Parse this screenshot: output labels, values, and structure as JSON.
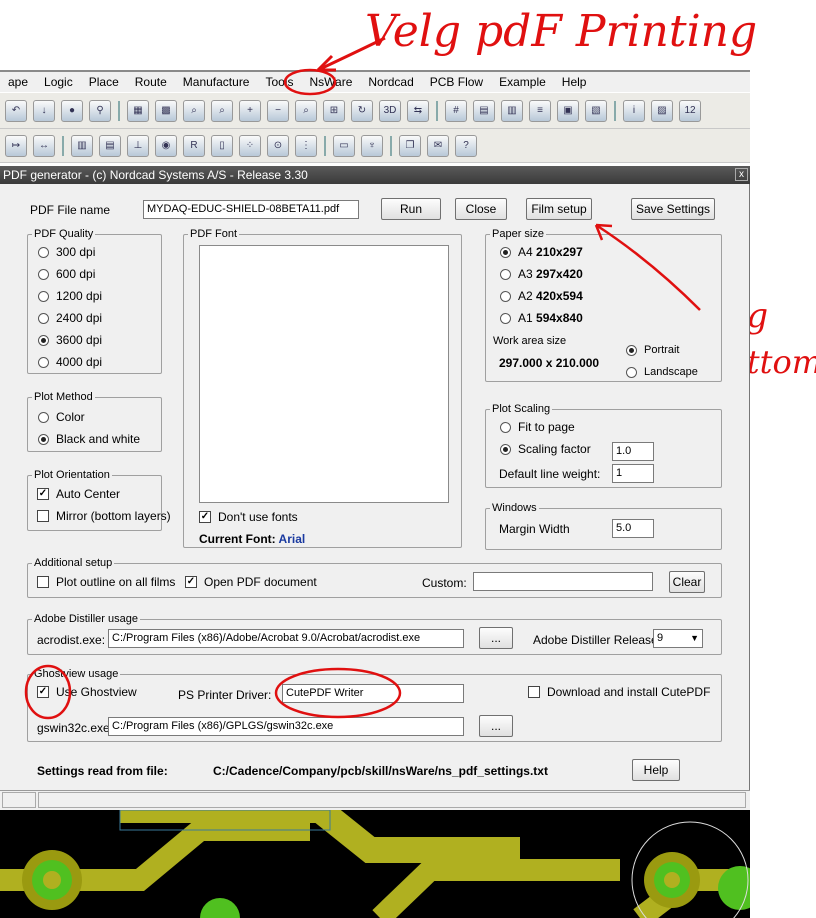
{
  "annotations": {
    "top": "Velg pdF Printing",
    "side_1": "Velg",
    "side_2": "Bottom"
  },
  "menu": [
    "ape",
    "Logic",
    "Place",
    "Route",
    "Manufacture",
    "Tools",
    "NsWare",
    "Nordcad",
    "PCB Flow",
    "Example",
    "Help"
  ],
  "dialog": {
    "title": "PDF generator - (c) Nordcad Systems A/S - Release 3.30",
    "close_glyph": "x",
    "pdf_file_label": "PDF File name",
    "pdf_file_value": "MYDAQ-EDUC-SHIELD-08BETA11.pdf",
    "buttons": {
      "run": "Run",
      "close": "Close",
      "film_setup": "Film setup",
      "save_settings": "Save Settings",
      "clear": "Clear",
      "browse1": "...",
      "browse2": "...",
      "help": "Help"
    },
    "pdf_quality": {
      "label": "PDF Quality",
      "options": [
        "300 dpi",
        "600 dpi",
        "1200 dpi",
        "2400 dpi",
        "3600 dpi",
        "4000 dpi"
      ],
      "selected": 4
    },
    "pdf_font": {
      "label": "PDF Font",
      "dont_use_fonts": "Don't use fonts",
      "current_font_label": "Current Font:",
      "current_font_value": "Arial"
    },
    "paper_size": {
      "label": "Paper size",
      "options": [
        {
          "code": "A4",
          "size": "210x297"
        },
        {
          "code": "A3",
          "size": "297x420"
        },
        {
          "code": "A2",
          "size": "420x594"
        },
        {
          "code": "A1",
          "size": "594x840"
        }
      ],
      "selected": 0,
      "work_area_label": "Work area size",
      "work_area_value": "297.000 x 210.000",
      "portrait": "Portrait",
      "landscape": "Landscape"
    },
    "plot_method": {
      "label": "Plot Method",
      "color": "Color",
      "bw": "Black and white"
    },
    "plot_orientation": {
      "label": "Plot Orientation",
      "auto_center": "Auto Center",
      "mirror": "Mirror (bottom layers)"
    },
    "plot_scaling": {
      "label": "Plot Scaling",
      "fit": "Fit to page",
      "factor": "Scaling factor",
      "factor_value": "1.0",
      "line_weight": "Default line weight:",
      "line_weight_value": "1"
    },
    "windows": {
      "label": "Windows",
      "margin": "Margin Width",
      "margin_value": "5.0"
    },
    "additional": {
      "label": "Additional setup",
      "plot_outline": "Plot outline on all films",
      "open_pdf": "Open PDF document",
      "custom": "Custom:"
    },
    "distiller": {
      "label": "Adobe Distiller usage",
      "exe_label": "acrodist.exe:",
      "exe_value": "C:/Program Files (x86)/Adobe/Acrobat 9.0/Acrobat/acrodist.exe",
      "release_label": "Adobe Distiller Release:",
      "release_value": "9"
    },
    "ghostview": {
      "label": "Ghostview usage",
      "use": "Use Ghostview",
      "driver_label": "PS Printer Driver:",
      "driver_value": "CutePDF Writer",
      "download": "Download and install CutePDF",
      "exe_label": "gswin32c.exe:",
      "exe_value": "C:/Program Files (x86)/GPLGS/gswin32c.exe"
    },
    "settings_label": "Settings read from file:",
    "settings_value": "C:/Cadence/Company/pcb/skill/nsWare/ns_pdf_settings.txt"
  },
  "colors": {
    "annotation": "#e01010",
    "trace": "#b0b020",
    "pad": "#50c020",
    "font_value": "#1a3aa0"
  }
}
